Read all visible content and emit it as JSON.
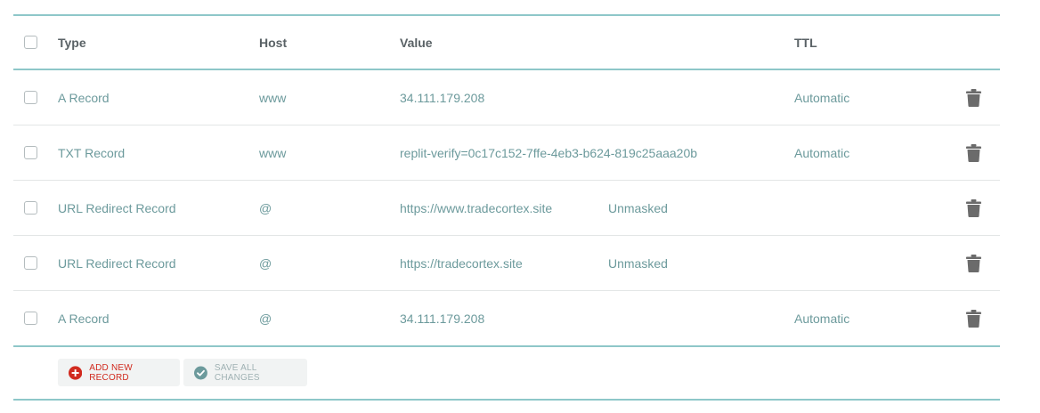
{
  "table": {
    "headers": {
      "type": "Type",
      "host": "Host",
      "value": "Value",
      "ttl": "TTL"
    },
    "rows": [
      {
        "type": "A Record",
        "host": "www",
        "value": "34.111.179.208",
        "masking": "",
        "ttl": "Automatic"
      },
      {
        "type": "TXT Record",
        "host": "www",
        "value": "replit-verify=0c17c152-7ffe-4eb3-b624-819c25aaa20b",
        "masking": "",
        "ttl": "Automatic"
      },
      {
        "type": "URL Redirect Record",
        "host": "@",
        "value": "https://www.tradecortex.site",
        "masking": "Unmasked",
        "ttl": ""
      },
      {
        "type": "URL Redirect Record",
        "host": "@",
        "value": "https://tradecortex.site",
        "masking": "Unmasked",
        "ttl": ""
      },
      {
        "type": "A Record",
        "host": "@",
        "value": "34.111.179.208",
        "masking": "",
        "ttl": "Automatic"
      }
    ]
  },
  "actions": {
    "add_label": "ADD NEW RECORD",
    "save_label": "SAVE ALL CHANGES"
  },
  "icons": {
    "add": "plus-circle-icon",
    "save": "check-circle-icon",
    "delete": "trash-icon"
  },
  "colors": {
    "accent_teal": "#8ec7c9",
    "text_teal": "#6c9a9c",
    "add_red": "#d12a1e",
    "save_gray": "#9fb1b3",
    "trash": "#6b6b6b"
  }
}
